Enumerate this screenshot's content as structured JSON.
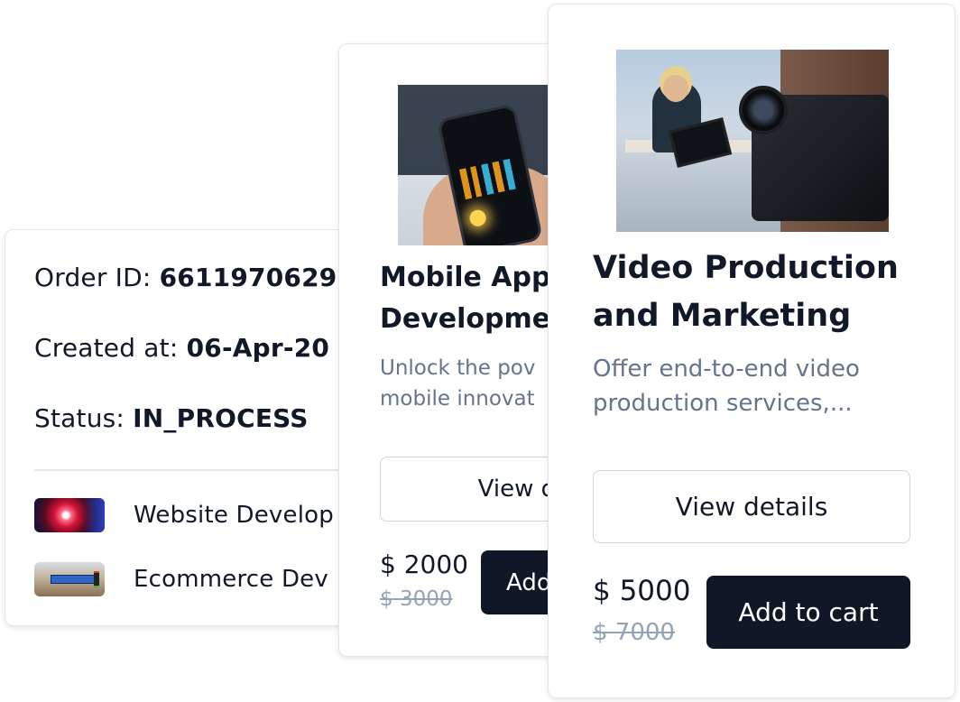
{
  "order": {
    "order_id_label": "Order ID: ",
    "order_id_value": "6611970629",
    "created_label": "Created at: ",
    "created_value": "06-Apr-20",
    "status_label": "Status: ",
    "status_value": "IN_PROCESS",
    "items": [
      {
        "label": "Website Develop",
        "thumb_icon": "website-development-thumbnail"
      },
      {
        "label": "Ecommerce Dev",
        "thumb_icon": "ecommerce-development-thumbnail"
      }
    ]
  },
  "services": [
    {
      "title_line1": "Mobile App",
      "title_line2": "Developme",
      "desc_line1": "Unlock the pov",
      "desc_line2": "mobile innovat",
      "view_label": "View det",
      "price": "$ 2000",
      "old_price": "$ 3000",
      "cart_label": "Add",
      "image_icon": "phone-app-photo"
    },
    {
      "title_line1": "Video Production",
      "title_line2": "and Marketing",
      "desc": "Offer end-to-end video production services,...",
      "view_label": "View details",
      "price": "$ 5000",
      "old_price": "$ 7000",
      "cart_label": "Add to cart",
      "image_icon": "video-studio-photo"
    }
  ],
  "colors": {
    "primary_button": "#101828",
    "muted_text": "#64748b",
    "old_price": "#94a3b8",
    "border": "#e5e7eb"
  }
}
